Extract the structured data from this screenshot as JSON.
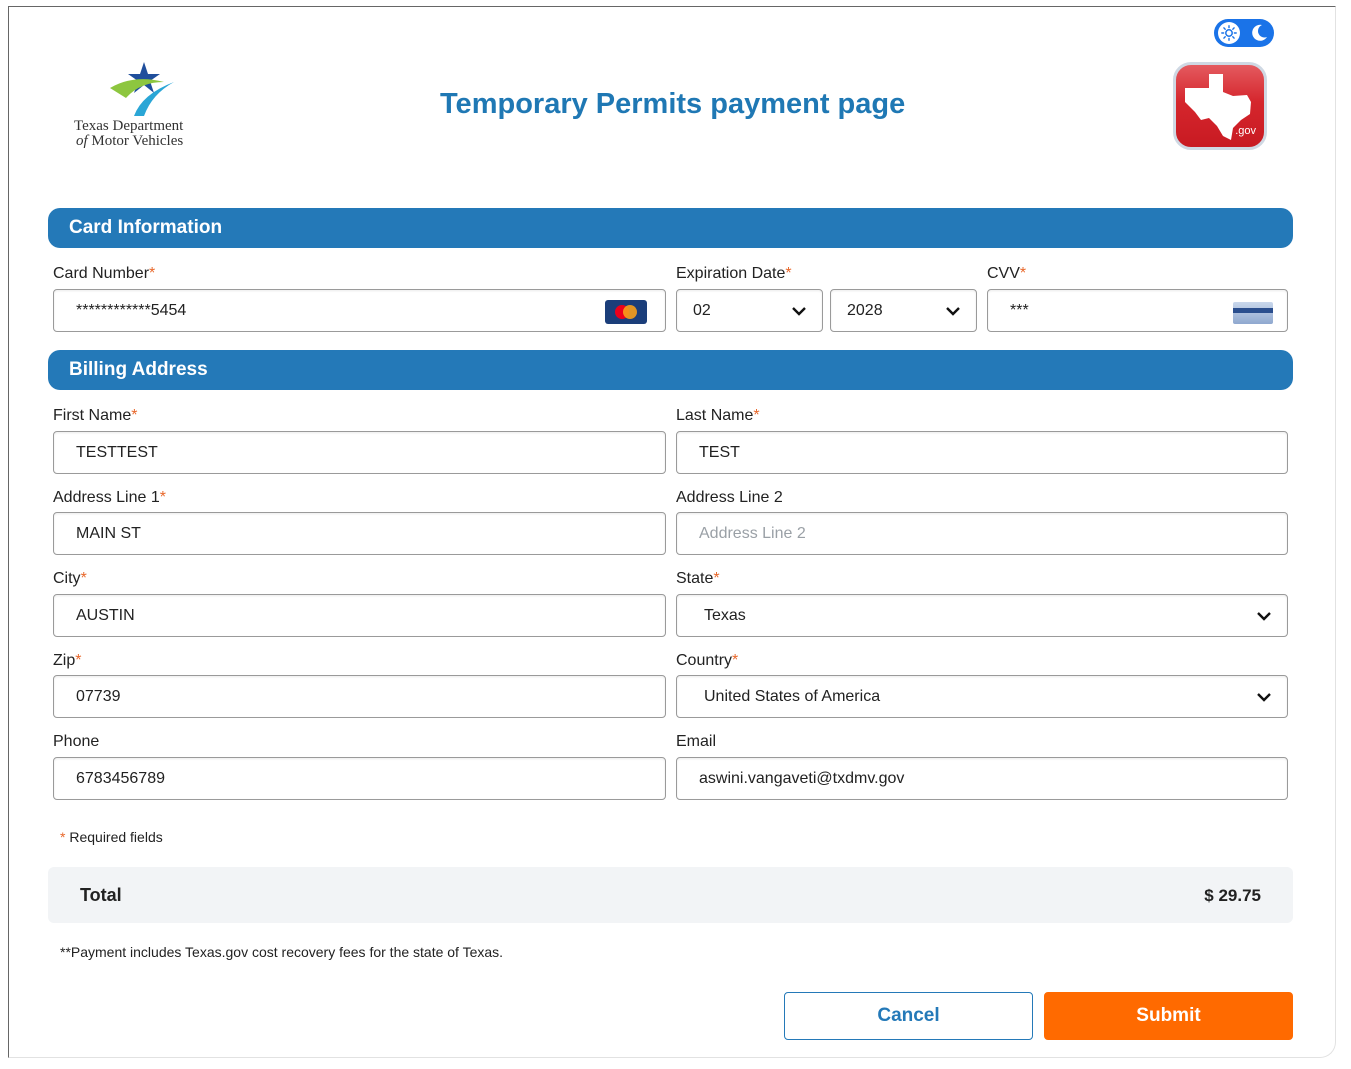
{
  "header": {
    "org_name_line1": "Texas Department",
    "org_name_line2_of": "of",
    "org_name_line2_rest": " Motor Vehicles",
    "page_title": "Temporary Permits payment page",
    "gov_logo_text": ".gov",
    "theme_toggle_icons": [
      "sun-icon",
      "moon-icon"
    ]
  },
  "card_section": {
    "title": "Card Information",
    "card_number": {
      "label": "Card Number",
      "value": "************5454",
      "brand_icon": "mastercard-icon"
    },
    "expiration": {
      "label": "Expiration Date",
      "month": "02",
      "year": "2028"
    },
    "cvv": {
      "label": "CVV",
      "value": "***",
      "icon": "cvv-card-icon"
    }
  },
  "billing_section": {
    "title": "Billing Address",
    "first_name": {
      "label": "First Name",
      "value": "TESTTEST"
    },
    "last_name": {
      "label": "Last Name",
      "value": "TEST"
    },
    "address1": {
      "label": "Address Line 1",
      "value": "MAIN ST"
    },
    "address2": {
      "label": "Address Line 2",
      "placeholder": "Address Line 2"
    },
    "city": {
      "label": "City",
      "value": "AUSTIN"
    },
    "state": {
      "label": "State",
      "value": "Texas"
    },
    "zip": {
      "label": "Zip",
      "value": "07739"
    },
    "country": {
      "label": "Country",
      "value": "United States of America"
    },
    "phone": {
      "label": "Phone",
      "value": "6783456789"
    },
    "email": {
      "label": "Email",
      "value": "aswini.vangaveti@txdmv.gov"
    }
  },
  "required_marker": "*",
  "required_note": "Required fields",
  "total": {
    "label": "Total",
    "value": "$ 29.75"
  },
  "fee_note": "**Payment includes Texas.gov cost recovery fees for the state of Texas.",
  "buttons": {
    "cancel": "Cancel",
    "submit": "Submit"
  },
  "colors": {
    "accent": "#2479b8",
    "submit": "#ff6a00",
    "required": "#e8672a",
    "title": "#1f78b4"
  }
}
